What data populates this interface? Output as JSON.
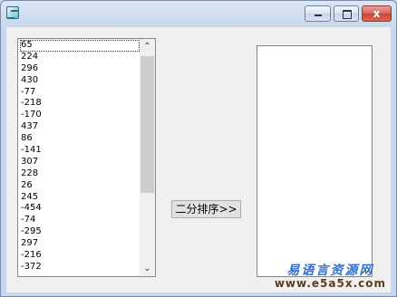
{
  "window": {
    "title": ""
  },
  "title_bar": {
    "icons": [
      "app-icon",
      "minimize-icon",
      "maximize-icon",
      "close-icon"
    ],
    "close_label": "x"
  },
  "left_list": {
    "items": [
      "65",
      "224",
      "296",
      "430",
      "-77",
      "-218",
      "-170",
      "437",
      "86",
      "-141",
      "307",
      "228",
      "26",
      "245",
      "-454",
      "-74",
      "-295",
      "297",
      "-216",
      "-372"
    ]
  },
  "sort_button": {
    "label": "二分排序>>"
  },
  "right_list": {
    "items": []
  },
  "watermark": {
    "chinese": "易语言资源网",
    "url": "www.e5a5x.com"
  }
}
